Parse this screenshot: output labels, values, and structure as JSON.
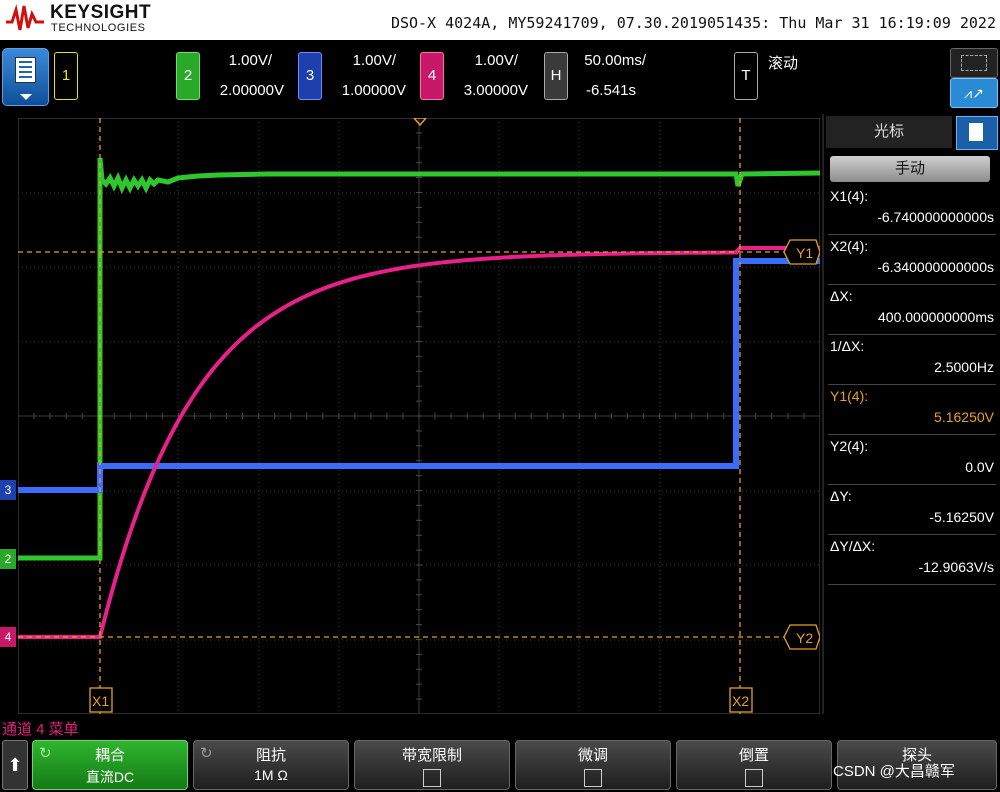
{
  "header": {
    "brand_name": "KEYSIGHT",
    "brand_sub": "TECHNOLOGIES",
    "device_info": "DSO-X 4024A, MY59241709, 07.30.2019051435: Thu Mar 31 16:19:09 2022"
  },
  "channels": [
    {
      "num": "1",
      "color": "#e8e800",
      "scale": "",
      "offset": ""
    },
    {
      "num": "2",
      "color": "#33cc33",
      "scale": "1.00V/",
      "offset": "2.00000V"
    },
    {
      "num": "3",
      "color": "#3366ff",
      "scale": "1.00V/",
      "offset": "1.00000V"
    },
    {
      "num": "4",
      "color": "#e0207a",
      "scale": "1.00V/",
      "offset": "3.00000V"
    }
  ],
  "horizontal": {
    "label": "H",
    "timebase": "50.00ms/",
    "delay": "-6.541s"
  },
  "trigger": {
    "label": "T",
    "mode": "滚动"
  },
  "grid_labels": {
    "y1": "Y1",
    "y2": "Y2",
    "x1": "X1",
    "x2": "X2",
    "ch1_marker": "1",
    "ch2_marker": "2",
    "ch3_marker": "3",
    "ch4_marker": "4"
  },
  "panel": {
    "tab_label": "光标",
    "mode_button": "手动",
    "rows": [
      {
        "label": "X1(4):",
        "value": "-6.740000000000s"
      },
      {
        "label": "X2(4):",
        "value": "-6.340000000000s"
      },
      {
        "label": "ΔX:",
        "value": "400.000000000ms"
      },
      {
        "label": "1/ΔX:",
        "value": "2.5000Hz"
      },
      {
        "label": "Y1(4):",
        "value": "5.16250V"
      },
      {
        "label": "Y2(4):",
        "value": "0.0V"
      },
      {
        "label": "ΔY:",
        "value": "-5.16250V"
      },
      {
        "label": "ΔY/ΔX:",
        "value": "-12.9063V/s"
      }
    ]
  },
  "menu": {
    "title": "通道 4 菜单",
    "softkeys": [
      {
        "title": "耦合",
        "value": "直流DC"
      },
      {
        "title": "阻抗",
        "value": "1M Ω"
      },
      {
        "title": "带宽限制",
        "value": ""
      },
      {
        "title": "微调",
        "value": ""
      },
      {
        "title": "倒置",
        "value": ""
      },
      {
        "title": "探头",
        "value": ""
      }
    ]
  },
  "watermark": "CSDN @大昌赣军"
}
